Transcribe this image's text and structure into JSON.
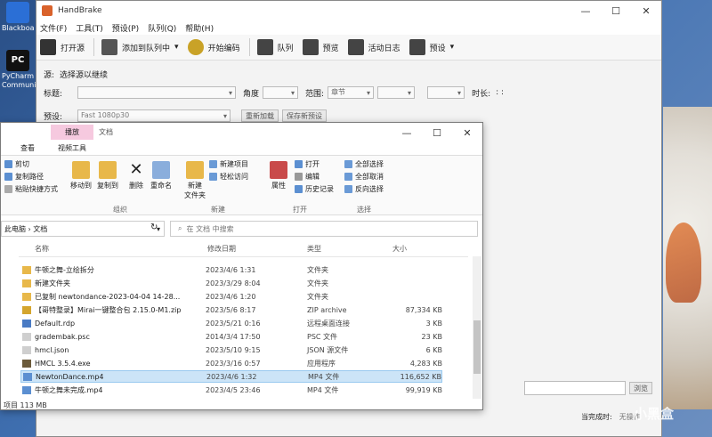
{
  "desktop": {
    "icons": [
      {
        "label": "Blackboard",
        "icon": "app-icon"
      },
      {
        "label": "PyCharm Community",
        "icon": "pycharm-icon"
      }
    ]
  },
  "handbrake": {
    "title": "HandBrake",
    "window_buttons": [
      "—",
      "☐",
      "✕"
    ],
    "menu": [
      "文件(F)",
      "工具(T)",
      "预设(P)",
      "队列(Q)",
      "帮助(H)"
    ],
    "toolbar": {
      "open": "打开源",
      "add_queue": "添加到队列中",
      "start": "开始编码",
      "queue": "队列",
      "preview": "预览",
      "activity": "活动日志",
      "presets": "预设"
    },
    "source_label": "源:",
    "source_value": "选择源以继续",
    "title_label": "标题:",
    "angle_label": "角度",
    "range_label": "范围:",
    "range_value": "章节",
    "duration_label": "时长:",
    "duration_value": ": :",
    "preset_label": "预设:",
    "preset_value": "Fast 1080p30",
    "reload": "重新加载",
    "save_preset": "保存新预设",
    "browse": "浏览",
    "when_done_label": "当完成时:",
    "when_done_value": "无操作"
  },
  "explorer": {
    "manage_tab": "播放",
    "doc_tab": "文档",
    "window_buttons": [
      "—",
      "☐",
      "✕"
    ],
    "ribbon_tabs": [
      "查看",
      "视频工具"
    ],
    "clipboard": {
      "cut": "剪切",
      "copy_path": "复制路径",
      "paste_shortcut": "粘贴快捷方式"
    },
    "organize": {
      "move": "移动到",
      "copy": "复制到",
      "delete": "删除",
      "rename": "重命名",
      "label": "组织"
    },
    "new": {
      "folder": "新建\n文件夹",
      "new_item": "新建项目",
      "easy_access": "轻松访问",
      "label": "新建"
    },
    "open_grp": {
      "properties": "属性",
      "open": "打开",
      "edit": "编辑",
      "history": "历史记录",
      "label": "打开"
    },
    "select": {
      "all": "全部选择",
      "none": "全部取消",
      "invert": "反向选择",
      "label": "选择"
    },
    "address": "此电脑 › 文档",
    "search_placeholder": "在 文档 中搜索",
    "columns": {
      "name": "名称",
      "date": "修改日期",
      "type": "类型",
      "size": "大小"
    },
    "files": [
      {
        "name": "牛顿之舞-立绘拆分",
        "date": "2023/4/6 1:31",
        "type": "文件夹",
        "size": "",
        "icon": "folder-icon"
      },
      {
        "name": "新建文件夹",
        "date": "2023/3/29 8:04",
        "type": "文件夹",
        "size": "",
        "icon": "folder-icon"
      },
      {
        "name": "已复制 newtondance-2023-04-04 14-28...",
        "date": "2023/4/6 1:20",
        "type": "文件夹",
        "size": "",
        "icon": "folder-icon"
      },
      {
        "name": "【哥特整录】Mirai一键整合包 2.15.0-M1.zip",
        "date": "2023/5/6 8:17",
        "type": "ZIP archive",
        "size": "87,334 KB",
        "icon": "zip-icon"
      },
      {
        "name": "Default.rdp",
        "date": "2023/5/21 0:16",
        "type": "远程桌面连接",
        "size": "3 KB",
        "icon": "rdp-icon"
      },
      {
        "name": "gradembak.psc",
        "date": "2014/3/4 17:50",
        "type": "PSC 文件",
        "size": "23 KB",
        "icon": "file-icon"
      },
      {
        "name": "hmcl.json",
        "date": "2023/5/10 9:15",
        "type": "JSON 源文件",
        "size": "6 KB",
        "icon": "file-icon"
      },
      {
        "name": "HMCL 3.5.4.exe",
        "date": "2023/3/16 0:57",
        "type": "应用程序",
        "size": "4,283 KB",
        "icon": "exe-icon"
      },
      {
        "name": "NewtonDance.mp4",
        "date": "2023/4/6 1:32",
        "type": "MP4 文件",
        "size": "116,652 KB",
        "icon": "video-icon",
        "selected": true
      },
      {
        "name": "牛顿之舞未完成.mp4",
        "date": "2023/4/5 23:46",
        "type": "MP4 文件",
        "size": "99,919 KB",
        "icon": "video-icon"
      }
    ],
    "status": "项目 113 MB"
  },
  "watermark": "小黑盒",
  "colors": {
    "manage_tab": "#f6c9df",
    "selected_row": "#cce4f7",
    "folder": "#e8b84a"
  }
}
